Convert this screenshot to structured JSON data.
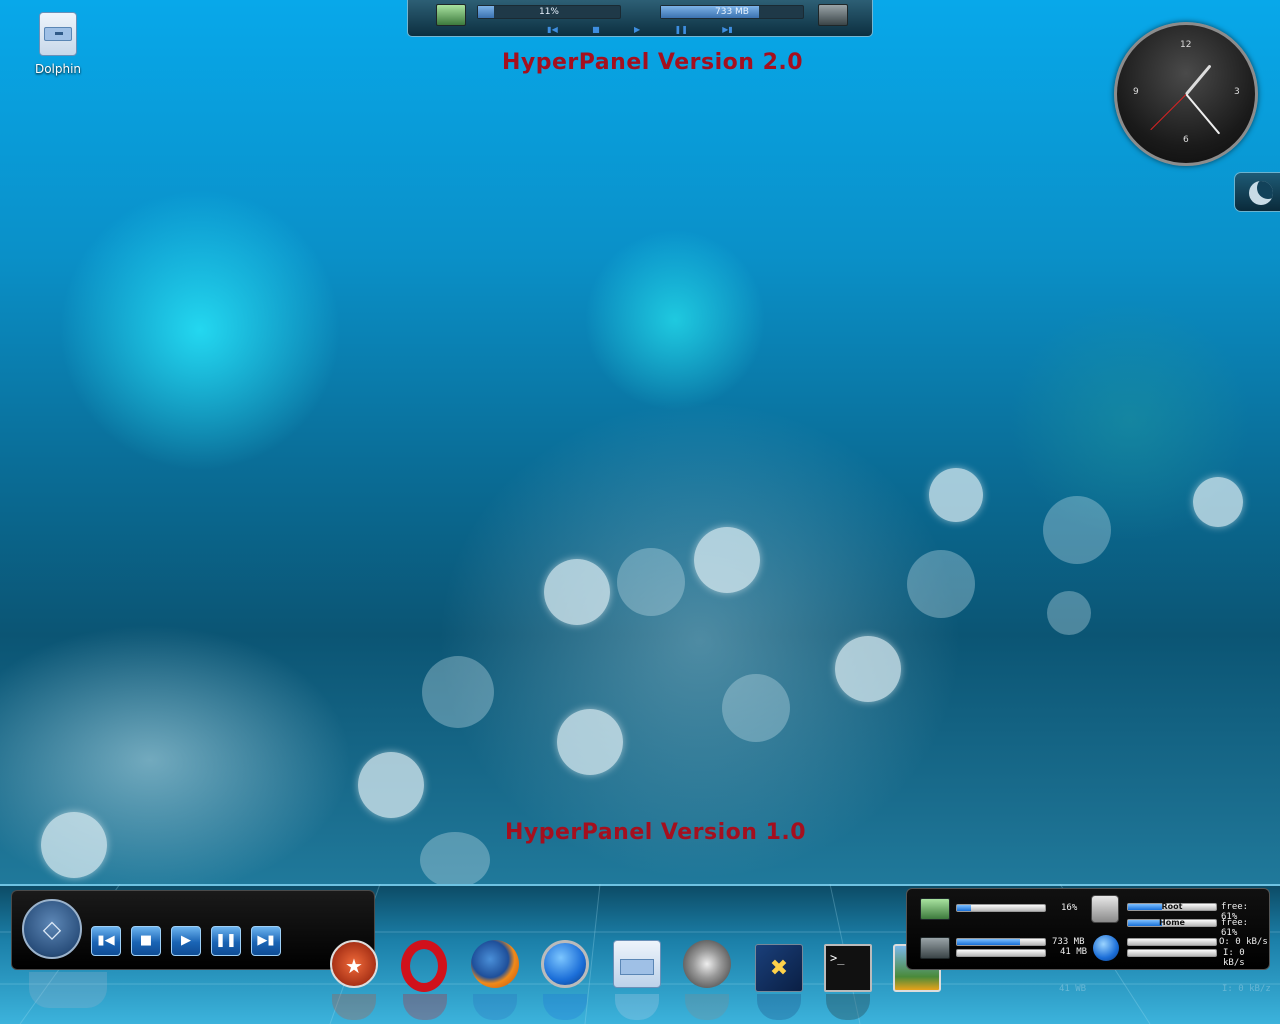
{
  "desktop": {
    "icon_label": "Dolphin"
  },
  "top_panel": {
    "cpu_text": "11%",
    "cpu_fraction": 0.11,
    "mem_text": "733 MB",
    "mem_fraction": 0.69,
    "controls": [
      "prev-icon",
      "stop-icon",
      "play-icon",
      "pause-icon",
      "next-icon"
    ]
  },
  "captions": {
    "top": "HyperPanel Version 2.0",
    "bottom": "HyperPanel Version 1.0"
  },
  "clock": {
    "n12": "12",
    "n3": "3",
    "n6": "6",
    "n9": "9"
  },
  "player": {
    "buttons": [
      "prev-icon",
      "stop-icon",
      "play-icon",
      "pause-icon",
      "next-icon"
    ]
  },
  "dock": {
    "icons": [
      "hypercolor-icon",
      "opera-icon",
      "firefox-icon",
      "network-globe-icon",
      "dolphin-icon",
      "multimedia-icon",
      "system-settings-icon",
      "terminal-icon",
      "image-viewer-icon"
    ],
    "terminal_prompt": ">_"
  },
  "sysmon": {
    "cpu_text": "16%",
    "cpu_fraction": 0.16,
    "mem_text": "733 MB",
    "swap_text": "41 MB",
    "mem_fraction": 0.72,
    "disks": [
      {
        "label": "Root",
        "free_text": "free: 61%",
        "used_fraction": 0.39
      },
      {
        "label": "Home",
        "free_text": "free: 61%",
        "used_fraction": 0.39
      }
    ],
    "net_out": "O: 0 kB/s",
    "net_in": "I: 0 kB/s",
    "reflection_swap": "41 WB",
    "reflection_net": "I: 0 kB/z"
  },
  "colors": {
    "caption": "#a50f1e",
    "accent": "#1870d8"
  }
}
